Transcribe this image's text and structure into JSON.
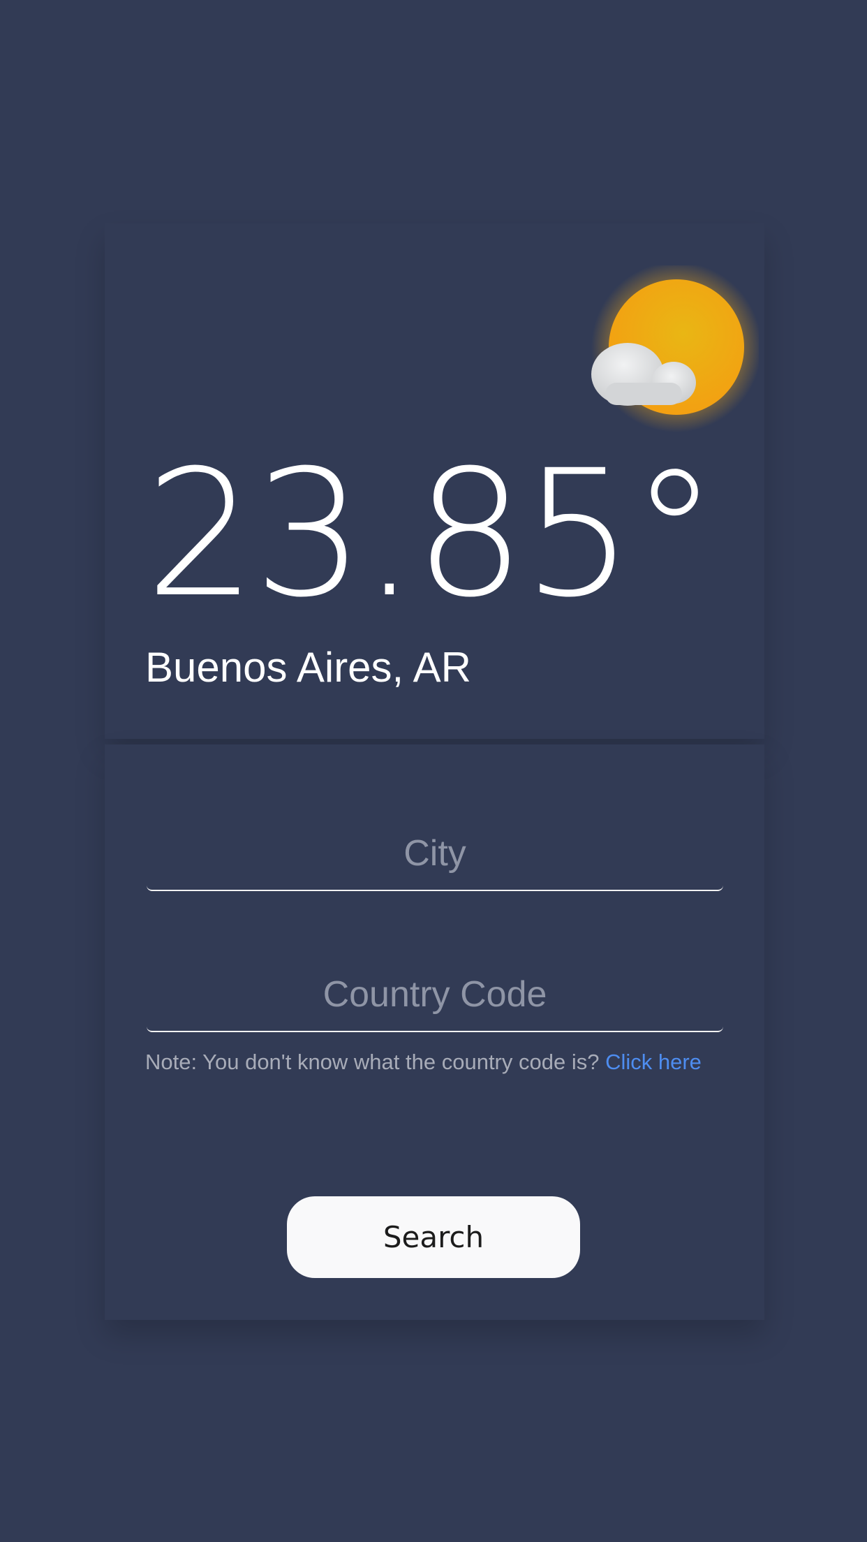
{
  "weather": {
    "temperature": "23.85°",
    "location": "Buenos Aires, AR",
    "icon": "sun-cloud-icon"
  },
  "form": {
    "city_placeholder": "City",
    "city_value": "",
    "country_placeholder": "Country Code",
    "country_value": "",
    "note_text": "Note: You don't know what the country code is?",
    "note_link": "Click here",
    "search_label": "Search"
  },
  "colors": {
    "background": "#323b55",
    "sun": "#f2ae18",
    "link": "#4e8df0",
    "button_bg": "#f9f9fa"
  }
}
